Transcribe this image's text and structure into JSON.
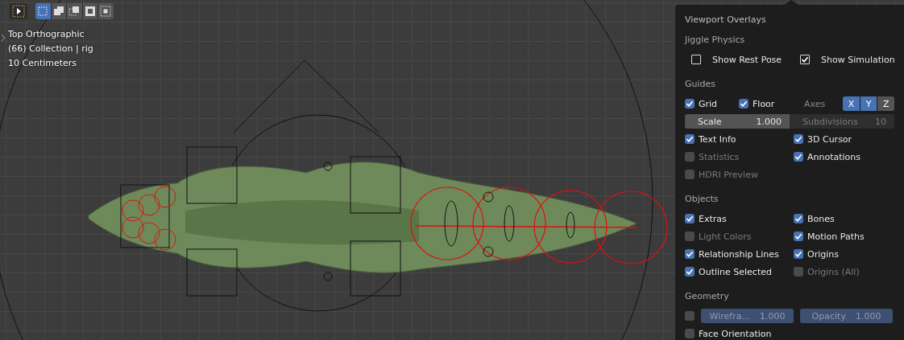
{
  "toolbar": {
    "mode_buttons": [
      {
        "kind": "set",
        "selected": true
      },
      {
        "kind": "extend",
        "selected": false
      },
      {
        "kind": "subtract",
        "selected": false
      },
      {
        "kind": "invert",
        "selected": false
      },
      {
        "kind": "intersect",
        "selected": false
      }
    ]
  },
  "viewport_info": [
    "Top Orthographic",
    "(66) Collection | rig",
    "10 Centimeters"
  ],
  "panel": {
    "title": "Viewport Overlays",
    "sections": [
      {
        "title": "Jiggle Physics",
        "rows": [
          {
            "kind": "plain_checks",
            "cells": [
              {
                "label": "Show Rest Pose",
                "checked": false,
                "disabled": false
              },
              {
                "label": "Show Simulation",
                "checked": true,
                "disabled": false
              }
            ]
          }
        ]
      },
      {
        "title": "Guides",
        "rows": [
          {
            "kind": "grid_axes",
            "cells": [
              {
                "label": "Grid",
                "checked": true,
                "disabled": false
              },
              {
                "label": "Floor",
                "checked": true,
                "disabled": false
              }
            ],
            "axes_label": "Axes",
            "axes": [
              {
                "label": "X",
                "selected": true
              },
              {
                "label": "Y",
                "selected": true
              },
              {
                "label": "Z",
                "selected": false
              }
            ]
          },
          {
            "kind": "fields",
            "fields": [
              {
                "label": "Scale",
                "value": "1.000",
                "disabled": false
              },
              {
                "label": "Subdivisions",
                "value": "10",
                "disabled": true
              }
            ]
          },
          {
            "kind": "checks",
            "cells": [
              {
                "label": "Text Info",
                "checked": true,
                "disabled": false
              },
              {
                "label": "3D Cursor",
                "checked": true,
                "disabled": false
              }
            ]
          },
          {
            "kind": "checks",
            "cells": [
              {
                "label": "Statistics",
                "checked": false,
                "disabled": true
              },
              {
                "label": "Annotations",
                "checked": true,
                "disabled": false
              }
            ]
          },
          {
            "kind": "checks",
            "cells": [
              {
                "label": "HDRI Preview",
                "checked": false,
                "disabled": true
              }
            ]
          }
        ]
      },
      {
        "title": "Objects",
        "rows": [
          {
            "kind": "checks",
            "cells": [
              {
                "label": "Extras",
                "checked": true,
                "disabled": false
              },
              {
                "label": "Bones",
                "checked": true,
                "disabled": false
              }
            ]
          },
          {
            "kind": "checks",
            "cells": [
              {
                "label": "Light Colors",
                "checked": false,
                "disabled": true
              },
              {
                "label": "Motion Paths",
                "checked": true,
                "disabled": false
              }
            ]
          },
          {
            "kind": "checks",
            "cells": [
              {
                "label": "Relationship Lines",
                "checked": true,
                "disabled": false
              },
              {
                "label": "Origins",
                "checked": true,
                "disabled": false
              }
            ]
          },
          {
            "kind": "checks",
            "cells": [
              {
                "label": "Outline Selected",
                "checked": true,
                "disabled": false
              },
              {
                "label": "Origins (All)",
                "checked": false,
                "disabled": true
              }
            ]
          }
        ]
      },
      {
        "title": "Geometry",
        "rows": [
          {
            "kind": "slider_row",
            "checked": false,
            "fields": [
              {
                "label": "Wirefra...",
                "value": "1.000",
                "disabled": true
              },
              {
                "label": "Opacity",
                "value": "1.000",
                "disabled": true
              }
            ]
          },
          {
            "kind": "checks",
            "cells": [
              {
                "label": "Face Orientation",
                "checked": false,
                "disabled": false
              }
            ]
          }
        ]
      }
    ]
  }
}
